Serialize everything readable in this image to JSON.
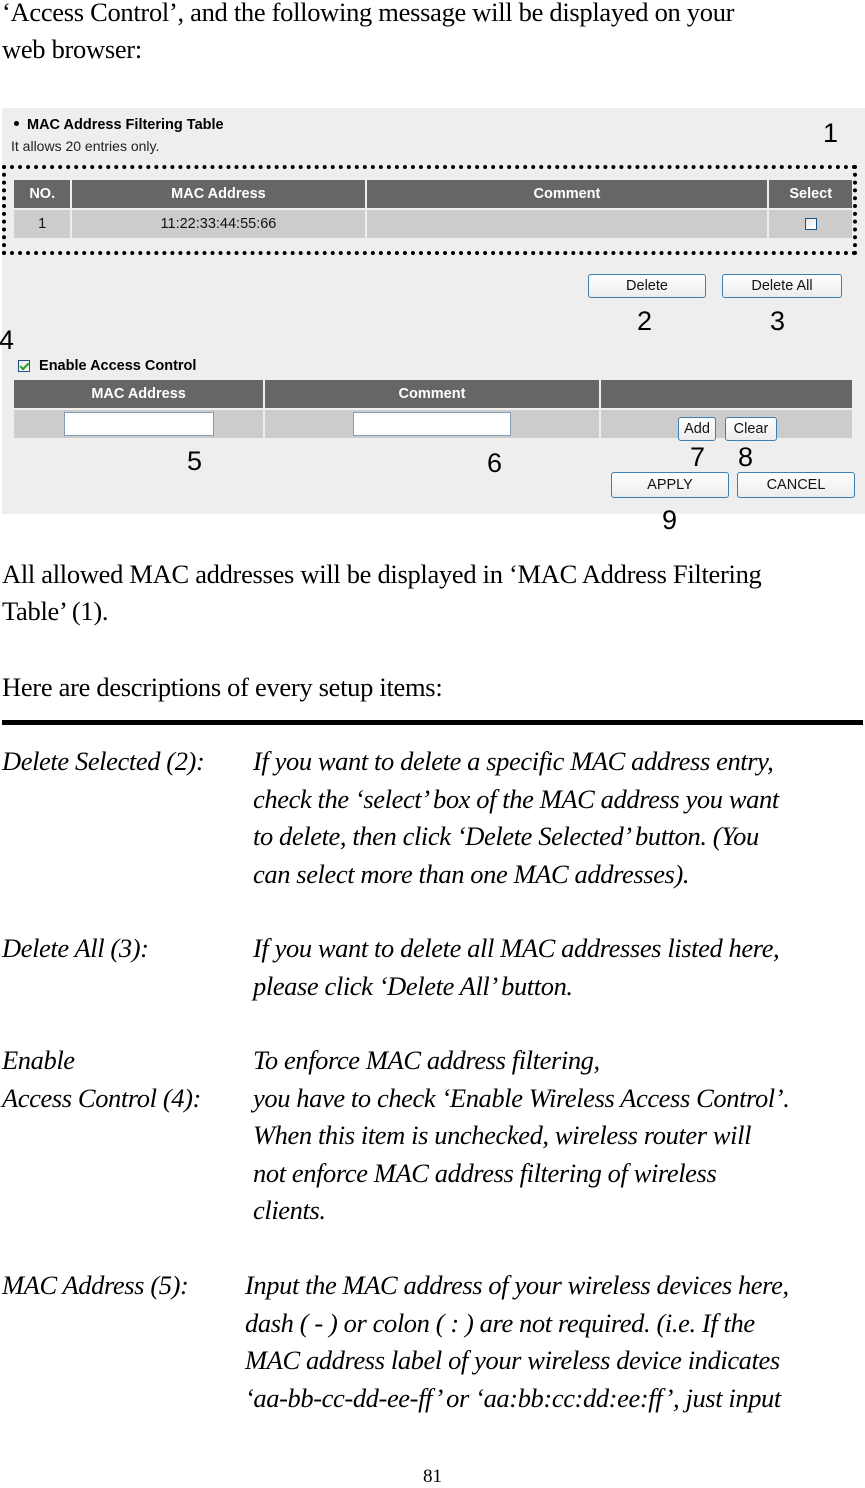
{
  "intro": {
    "line1": "‘Access Control’, and the following message will be displayed on your",
    "line2": "web browser:"
  },
  "screenshot": {
    "filter_table": {
      "title": "MAC Address Filtering Table",
      "note": "It allows 20 entries only.",
      "columns": [
        "NO.",
        "MAC Address",
        "Comment",
        "Select"
      ],
      "rows": [
        {
          "no": "1",
          "mac": "11:22:33:44:55:66",
          "comment": "",
          "selected": false
        }
      ]
    },
    "buttons": {
      "delete": "Delete",
      "delete_all": "Delete All",
      "add": "Add",
      "clear": "Clear",
      "apply": "APPLY",
      "cancel": "CANCEL"
    },
    "enable_access_control": {
      "label": "Enable Access Control",
      "checked": true
    },
    "input_table": {
      "columns": [
        "MAC Address",
        "Comment",
        ""
      ],
      "mac_value": "",
      "comment_value": ""
    },
    "callouts": [
      "1",
      "2",
      "3",
      "4",
      "5",
      "6",
      "7",
      "8",
      "9"
    ]
  },
  "body": {
    "para1_line1": "All allowed MAC addresses will be displayed in ‘MAC Address Filtering",
    "para1_line2": "Table’ (1).",
    "para2": "Here are descriptions of every setup items:",
    "items": [
      {
        "label_lines": [
          "Delete Selected (2):"
        ],
        "text_lines": [
          "If you want to delete a specific MAC address entry,",
          "check the ‘select’ box of the MAC address you want",
          "to delete, then click ‘Delete Selected’ button. (You",
          "can select more than one MAC addresses)."
        ]
      },
      {
        "label_lines": [
          "Delete All (3):"
        ],
        "text_lines": [
          "If you want to delete all MAC addresses listed here,",
          "please click ‘Delete All’ button."
        ]
      },
      {
        "label_lines": [
          "Enable",
          "Access Control (4):"
        ],
        "text_lines": [
          "To enforce MAC address filtering,",
          "you have to check ‘Enable Wireless Access Control’.",
          "When this item is unchecked, wireless router will",
          "not enforce MAC address filtering of wireless",
          "clients."
        ]
      },
      {
        "label_lines": [
          "MAC Address (5):"
        ],
        "text_lines": [
          "Input the MAC address of your wireless devices here,",
          "dash ( - ) or colon ( : ) are not required. (i.e. If the",
          "MAC address label of your wireless device indicates",
          "‘aa-bb-cc-dd-ee-ff’ or ‘aa:bb:cc:dd:ee:ff’, just input"
        ]
      }
    ]
  },
  "page_number": "81"
}
